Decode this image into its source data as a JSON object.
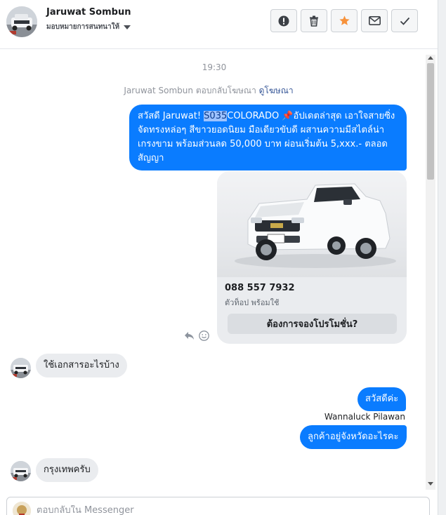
{
  "header": {
    "contact_name": "Jaruwat Sombun",
    "assign_label": "มอบหมายการสนทนาให้",
    "actions": [
      "report-icon",
      "trash-icon",
      "star-icon",
      "envelope-icon",
      "check-icon"
    ]
  },
  "conversation": {
    "timestamp": "19:30",
    "replied_prefix": "Jaruwat Sombun ตอบกลับโฆษณา",
    "replied_link": "ดูโฆษณา",
    "ad_message": {
      "greeting": "สวัสดี Jaruwat! ",
      "highlight": "S035",
      "rest": "COLORADO ",
      "pin": "📌",
      "body": "อัปเดตล่าสุด เอาใจสายซิ่ง จัดทรงหล่อๆ สีขาวยอดนิยม มือเดียวขับดี ผสานความมีสไตล์น่าเกรงขาม พร้อมส่วนลด 50,000 บาท ผ่อนเริ่มต้น 5,xxx.- ตลอดสัญญา"
    },
    "card": {
      "phone": "088 557 7932",
      "subtitle": "ตัวท็อป พร้อมใช้",
      "button": "ต้องการจองโปรโมชั่น?"
    },
    "msg_in_1": "ใช้เอกสารอะไรบ้าง",
    "msg_out_1": "สวัสดีค่ะ",
    "sender_name": "Wannaluck Pilawan",
    "msg_out_2": "ลูกค้าอยู่จังหวัดอะไรคะ",
    "msg_in_2": "กรุงเทพครับ"
  },
  "composer": {
    "placeholder": "ตอบกลับใน Messenger"
  },
  "colors": {
    "outgoing_bubble": "#0a7cff",
    "incoming_bubble": "#eaecef",
    "star_accent": "#f7923b"
  }
}
